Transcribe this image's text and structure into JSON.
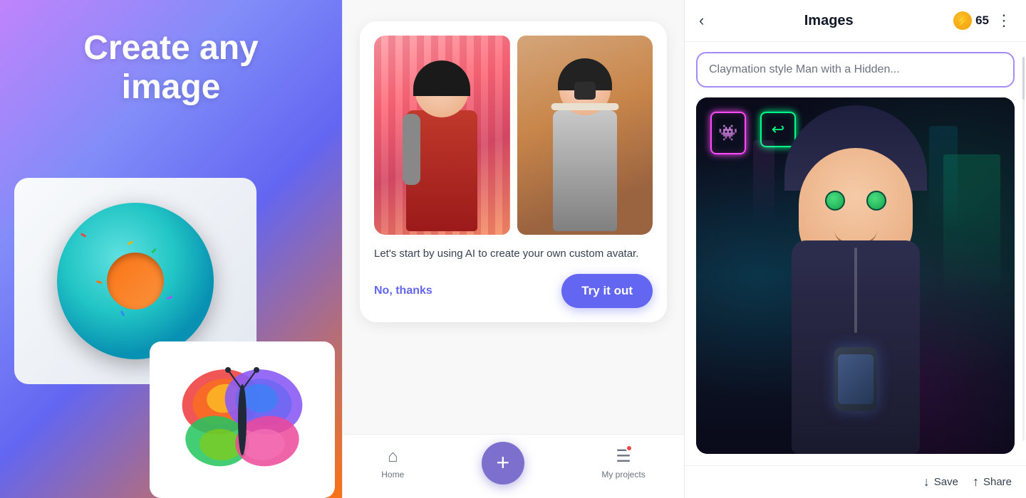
{
  "panel1": {
    "title_line1": "Create any",
    "title_line2": "image"
  },
  "panel2": {
    "card": {
      "description": "Let's start by using AI to create your own custom avatar.",
      "no_thanks_label": "No, thanks",
      "try_it_label": "Try it out"
    },
    "nav": {
      "home_label": "Home",
      "plus_label": "+",
      "my_projects_label": "My projects"
    }
  },
  "panel3": {
    "header": {
      "back_icon": "‹",
      "title": "Images",
      "coin_icon": "⚡",
      "coin_count": "65",
      "more_icon": "⋮"
    },
    "search": {
      "placeholder": "Claymation style Man with a Hidden..."
    },
    "footer": {
      "save_label": "Save",
      "share_label": "Share",
      "save_icon": "↓",
      "share_icon": "↑"
    }
  }
}
